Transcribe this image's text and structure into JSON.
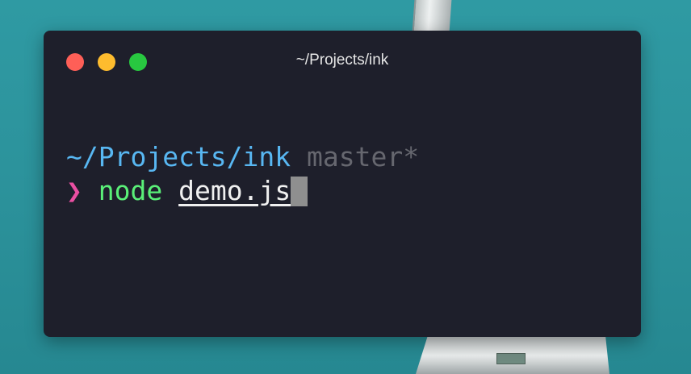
{
  "window": {
    "title": "~/Projects/ink"
  },
  "terminal": {
    "cwd": "~/Projects/ink",
    "branch": "master*",
    "prompt_symbol": "❯",
    "command": "node",
    "argument": "demo.js"
  },
  "colors": {
    "cwd": "#58b7f2",
    "branch": "#66676f",
    "prompt": "#ea4fa2",
    "command": "#5af078",
    "argument": "#f0f0f0",
    "background": "#1e1f2b"
  }
}
